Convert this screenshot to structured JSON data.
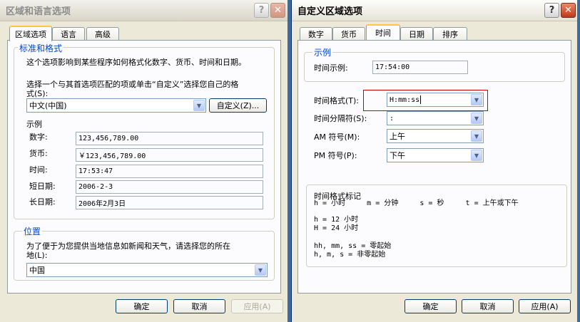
{
  "left_dialog": {
    "title": "区域和语言选项",
    "help_label": "?",
    "close_label": "✕",
    "tabs": [
      "区域选项",
      "语言",
      "高级"
    ],
    "standards_group": {
      "title": "标准和格式",
      "desc": "这个选项影响到某些程序如何格式化数字、货币、时间和日期。",
      "instruction_line1": "选择一个与其首选项匹配的项或单击“自定义”选择您自己的格",
      "instruction_line2": "式(S):",
      "locale_value": "中文(中国)",
      "customize_button": "自定义(Z)...",
      "sample_title": "示例",
      "samples": [
        {
          "label": "数字:",
          "value": "123,456,789.00"
        },
        {
          "label": "货币:",
          "value": "￥123,456,789.00"
        },
        {
          "label": "时间:",
          "value": "17:53:47"
        },
        {
          "label": "短日期:",
          "value": "2006-2-3"
        },
        {
          "label": "长日期:",
          "value": "2006年2月3日"
        }
      ]
    },
    "location_group": {
      "title": "位置",
      "desc_line1": "为了便于为您提供当地信息如新闻和天气，请选择您的所在",
      "desc_line2": "地(L):",
      "value": "中国"
    },
    "buttons": {
      "ok": "确定",
      "cancel": "取消",
      "apply": "应用(A)"
    }
  },
  "right_dialog": {
    "title": "自定义区域选项",
    "help_label": "?",
    "close_label": "✕",
    "tabs": [
      "数字",
      "货币",
      "时间",
      "日期",
      "排序"
    ],
    "active_tab": "时间",
    "sample_group": {
      "title": "示例",
      "label": "时间示例:",
      "value": "17:54:00"
    },
    "fields": [
      {
        "label": "时间格式(T):",
        "value": "H:mm:ss"
      },
      {
        "label": "时间分隔符(S):",
        "value": ":"
      },
      {
        "label": "AM 符号(M):",
        "value": "上午"
      },
      {
        "label": "PM 符号(P):",
        "value": "下午"
      }
    ],
    "highlight_color": "#cc0000",
    "hint": {
      "title": "时间格式标记",
      "line1": "h = 小时     m = 分钟     s = 秒     t = 上午或下午",
      "line2": "h = 12 小时",
      "line3": "H = 24 小时",
      "line4": "hh, mm, ss = 零起始",
      "line5": "h, m, s = 非零起始"
    },
    "buttons": {
      "ok": "确定",
      "cancel": "取消",
      "apply": "应用(A)"
    }
  },
  "drop_arrow": "▼",
  "colors": {
    "group_title": "#0046d5",
    "desktop": "#3d6c9a",
    "dialog_bg": "#ece9d8"
  }
}
